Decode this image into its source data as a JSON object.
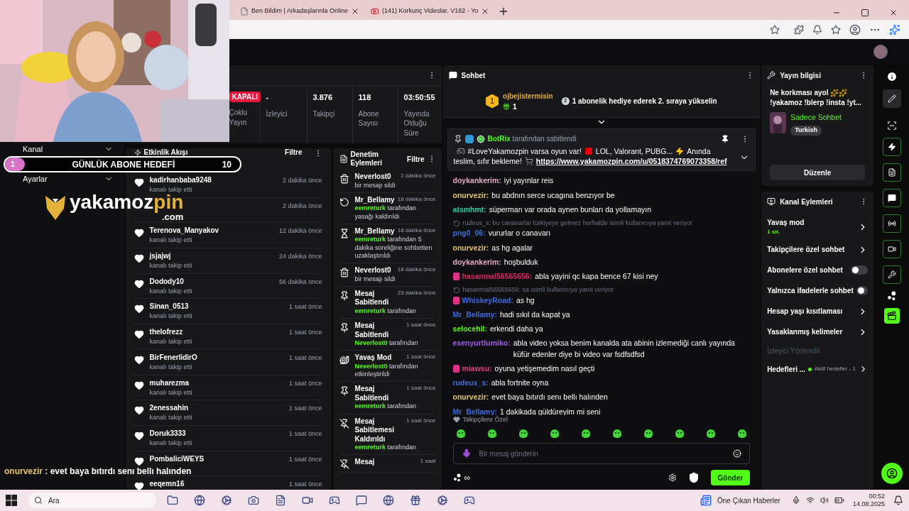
{
  "browser": {
    "tabs": [
      {
        "title": "Ben Bildim | Arkadaşlarınla Online",
        "selected": false,
        "kind": "page"
      },
      {
        "title": "(141) Korkunç Videolar. V182 - Yo",
        "selected": false,
        "kind": "video"
      }
    ]
  },
  "stats": [
    {
      "kind": "badge",
      "badge": "KAPALI",
      "label": "Çoklu Yayın"
    },
    {
      "kind": "value",
      "value": "-",
      "label": "İzleyici"
    },
    {
      "kind": "value",
      "value": "3.876",
      "label": "Takipçi"
    },
    {
      "kind": "value",
      "value": "118",
      "label": "Abone Sayısı"
    },
    {
      "kind": "value",
      "value": "03:50:55",
      "label": "Yayında Olduğu Süre"
    }
  ],
  "sidebar": {
    "items": [
      "Kanal",
      "Ayarlar"
    ]
  },
  "activity": {
    "title": "Etkinlik Akışı",
    "filter": "Filtre",
    "items": [
      {
        "user": "kadirhanbaba9248",
        "action": "kanalı takip etti",
        "time": "2 dakika önce"
      },
      {
        "time": "2 dakika önce"
      },
      {
        "user": "Terenova_Manyakov",
        "action": "kanalı takip etti",
        "time": "12 dakika önce"
      },
      {
        "user": "jsjajwj",
        "action": "kanalı takip etti",
        "time": "24 dakika önce"
      },
      {
        "user": "Dodody10",
        "action": "kanalı takip etti",
        "time": "56 dakika önce"
      },
      {
        "user": "Sinan_0513",
        "action": "kanalı takip etti",
        "time": "1 saat önce"
      },
      {
        "user": "thelofrezz",
        "action": "kanalı takip etti",
        "time": "1 saat önce"
      },
      {
        "user": "BirFenerlidirO",
        "action": "kanalı takip etti",
        "time": "1 saat önce"
      },
      {
        "user": "muharezma",
        "action": "kanalı takip etti",
        "time": "1 saat önce"
      },
      {
        "user": "2enessahin",
        "action": "kanalı takip etti",
        "time": "1 saat önce"
      },
      {
        "user": "Doruk3333",
        "action": "kanalı takip etti",
        "time": "1 saat önce"
      },
      {
        "user": "PombaliciWEYS",
        "time": "1 saat önce"
      },
      {
        "user": "eeqemn16",
        "time": "1 saat önce"
      }
    ]
  },
  "moderation": {
    "title": "Denetim Eylemleri",
    "filter": "Filtre",
    "items": [
      {
        "kind": "delete",
        "title": "Neverlost0",
        "time": "2 dakika önce",
        "detail": "bir mesajı sildi"
      },
      {
        "kind": "unban",
        "title": "Mr_Bellamy",
        "time": "18 dakika önce",
        "actor": "eemreturk",
        "detail": "tarafından yasağı kaldırıldı"
      },
      {
        "kind": "timeout",
        "title": "Mr_Bellamy",
        "time": "18 dakika önce",
        "actor": "eemreturk",
        "detail": "tarafından 5 dakika süreliğine sohbetten uzaklaştırıldı"
      },
      {
        "kind": "delete",
        "title": "Neverlost0",
        "time": "18 dakika önce",
        "detail": "bir mesajı sildi"
      },
      {
        "kind": "pin",
        "title": "Mesaj Sabitlendi",
        "time": "23 dakika önce",
        "actor": "eemreturk",
        "detail": "tarafından"
      },
      {
        "kind": "pin",
        "title": "Mesaj Sabitlendi",
        "time": "1 saat önce",
        "actor": "Neverlost0",
        "detail": "tarafından"
      },
      {
        "kind": "slow",
        "title": "Yavaş Mod",
        "time": "1 saat önce",
        "actor": "Neverlost0",
        "detail": "tarafından etkinleştirildi"
      },
      {
        "kind": "pin",
        "title": "Mesaj Sabitlendi",
        "time": "1 saat önce",
        "actor": "eemreturk",
        "detail": "tarafından"
      },
      {
        "kind": "unpin",
        "title": "Mesaj Sabitlemesi Kaldırıldı",
        "time": "1 saat önce",
        "actor": "eemreturk",
        "detail": "tarafından"
      },
      {
        "kind": "unpin",
        "title": "Mesaj",
        "time": "1 saat"
      }
    ]
  },
  "chat": {
    "title": "Sohbet",
    "top_gifter": {
      "rank": "1",
      "name": "ojbejistermisin",
      "count": "1"
    },
    "next_rank": {
      "rank": "2",
      "text": "1 abonelik hediye ederek 2. sıraya yükselin"
    },
    "pinned": {
      "by": "BotRix",
      "suffix": "tarafından sabitlendi",
      "parts": [
        "#LoveYakamozpin varsa oyun var!",
        "LOL, Valorant, PUBG...",
        "Anında teslim, sıfır bekleme!"
      ],
      "link": "https://www.yakamozpin.com/u/0518374769073358/ref"
    },
    "messages": [
      {
        "user": "doykankerim:",
        "color": "#e8a9c8",
        "text": "iyi yayınlar reis",
        "badge": false
      },
      {
        "user": "onurvezir:",
        "color": "#e3c46f",
        "text": "bu abdnın serce ucagına benzıyor be",
        "badge": false
      },
      {
        "user": "atsmhmt:",
        "color": "#2fcf9b",
        "text": "süperman var orada aynen bunları da yollamayın",
        "badge": false
      },
      {
        "user": "png0_06:",
        "color": "#3d6fe0",
        "text": "vururlar o canavarı",
        "badge": false,
        "reply": "rudeus_s: bu canavarlar türkiyeye gelmez herhalde isimli kullanıcıya yanıt veriyor"
      },
      {
        "user": "onurvezir:",
        "color": "#e3c46f",
        "text": "as hg agalar",
        "badge": false
      },
      {
        "user": "doykankerim:",
        "color": "#e8a9c8",
        "text": "hoşbulduk",
        "badge": false
      },
      {
        "user": "hasanmal56565656:",
        "color": "#e3245e",
        "text": "abla yayini qc kapa bence 67 kisi ney",
        "badge": true
      },
      {
        "user": "WhiskeyRoad:",
        "color": "#3d6be0",
        "text": "as hg",
        "badge": true,
        "reply": "hasanmal56565656: sa isimli kullanıcıya yanıt veriyor"
      },
      {
        "user": "Mr_Bellamy:",
        "color": "#3d6be0",
        "text": "hadi sıkıl da kapat ya",
        "badge": false
      },
      {
        "user": "selocehil:",
        "color": "#53fc18",
        "text": "erkendi daha ya",
        "badge": false
      },
      {
        "user": "esenyurtlumiko:",
        "color": "#9b5de5",
        "text": "abla video yoksa benim kanalda ata abinin izlemediği canlı yayında küfür edenler diye bi video var fsdfsdfsd",
        "badge": false
      },
      {
        "user": "miawsu:",
        "color": "#e3407b",
        "text": "oyuna yetişemedim nasıl geçti",
        "badge": true
      },
      {
        "user": "rudeus_s:",
        "color": "#3d6be0",
        "text": "abla fortnite oyna",
        "badge": false
      },
      {
        "user": "onurvezir:",
        "color": "#e3c46f",
        "text": "evet baya bıtırdı senı bellı halınden",
        "badge": false
      },
      {
        "user": "Mr_Bellamy:",
        "color": "#3d6be0",
        "text": "1 dakikada güldüreyim mi seni",
        "badge": false
      }
    ],
    "emote_label": "Takipçilere Özel",
    "input": {
      "placeholder": "Bir mesaj gönderin"
    },
    "points": "∞",
    "send": "Gönder"
  },
  "stream_info": {
    "title": "Yayın bilgisi",
    "stream_title": "Ne korkması ayol",
    "stream_title_rest": "!yakamoz !blerp !insta !yt...",
    "category": "Sadece Sohbet",
    "tag": "Turkish",
    "edit": "Düzenle"
  },
  "channel_actions": {
    "title": "Kanal Eylemleri",
    "items": [
      {
        "kind": "link",
        "label": "Yavaş mod",
        "sub": "1 sn."
      },
      {
        "kind": "link",
        "label": "Takipçilere özel sohbet"
      },
      {
        "kind": "toggle",
        "label": "Abonelere özel sohbet",
        "on": false
      },
      {
        "kind": "toggle",
        "label": "Yalnızca ifadelerle sohbet",
        "on": false
      },
      {
        "kind": "link",
        "label": "Hesap yaşı kısıtlaması"
      },
      {
        "kind": "link",
        "label": "Yasaklanmış kelimeler"
      },
      {
        "kind": "heading",
        "label": "İzleyici Yönlendir"
      },
      {
        "kind": "goal",
        "label": "Hedefleri ...",
        "status": "Aktif hedefler - 1"
      }
    ]
  },
  "overlay": {
    "goal": {
      "count": "1",
      "title": "GÜNLÜK ABONE HEDEFİ",
      "target": "10"
    },
    "logo": {
      "name": "yakamoz",
      "accent": "pin",
      "domain": ".com"
    },
    "caption": {
      "user": "onurvezir",
      "text": ": evet baya bıtırdı senı bellı halınden"
    }
  },
  "taskbar": {
    "search": "Ara",
    "news": "Öne Çıkan Haberler",
    "time": "00:52",
    "date": "14.08.2025"
  }
}
